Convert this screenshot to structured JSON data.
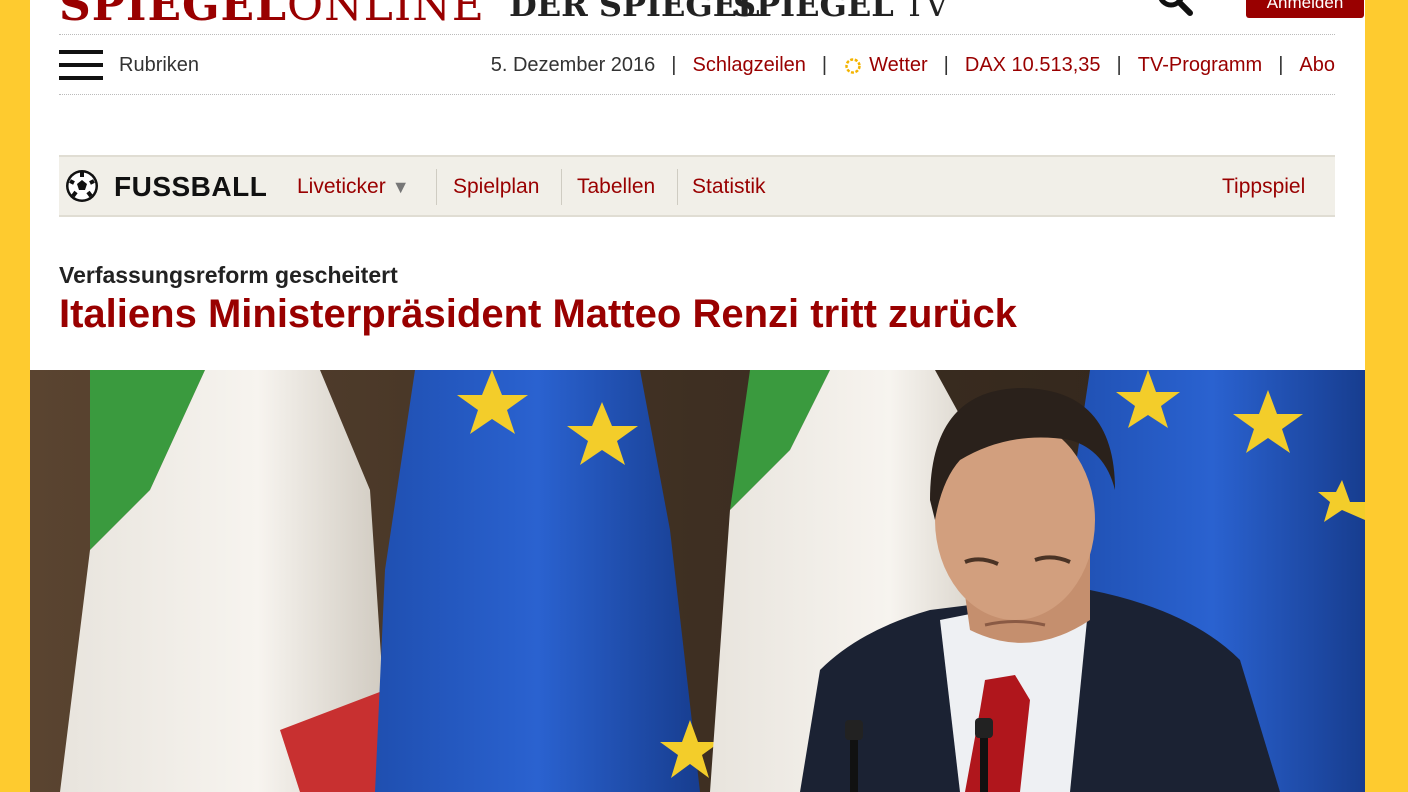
{
  "header": {
    "logo_main_bold": "SPIEGEL",
    "logo_main_light": "ONLINE",
    "logo_der_spiegel": "DER SPIEGEL",
    "logo_tv_bold": "SPIEGEL",
    "logo_tv_light": "TV",
    "login_label": "Anmelden"
  },
  "nav": {
    "rubriken_label": "Rubriken",
    "date": "5. Dezember 2016",
    "items": [
      {
        "label": "Schlagzeilen"
      },
      {
        "label": "Wetter"
      },
      {
        "label": "DAX 10.513,35"
      },
      {
        "label": "TV-Programm"
      },
      {
        "label": "Abo"
      }
    ],
    "separator": "|"
  },
  "fussball": {
    "title": "FUSSBALL",
    "links": [
      {
        "label": "Liveticker"
      },
      {
        "label": "Spielplan"
      },
      {
        "label": "Tabellen"
      },
      {
        "label": "Statistik"
      }
    ],
    "tippspiel": "Tippspiel"
  },
  "article": {
    "kicker": "Verfassungsreform gescheitert",
    "headline": "Italiens Ministerpräsident Matteo Renzi tritt zurück"
  },
  "colors": {
    "brand_red": "#990000",
    "page_bg": "#fecb2f"
  }
}
